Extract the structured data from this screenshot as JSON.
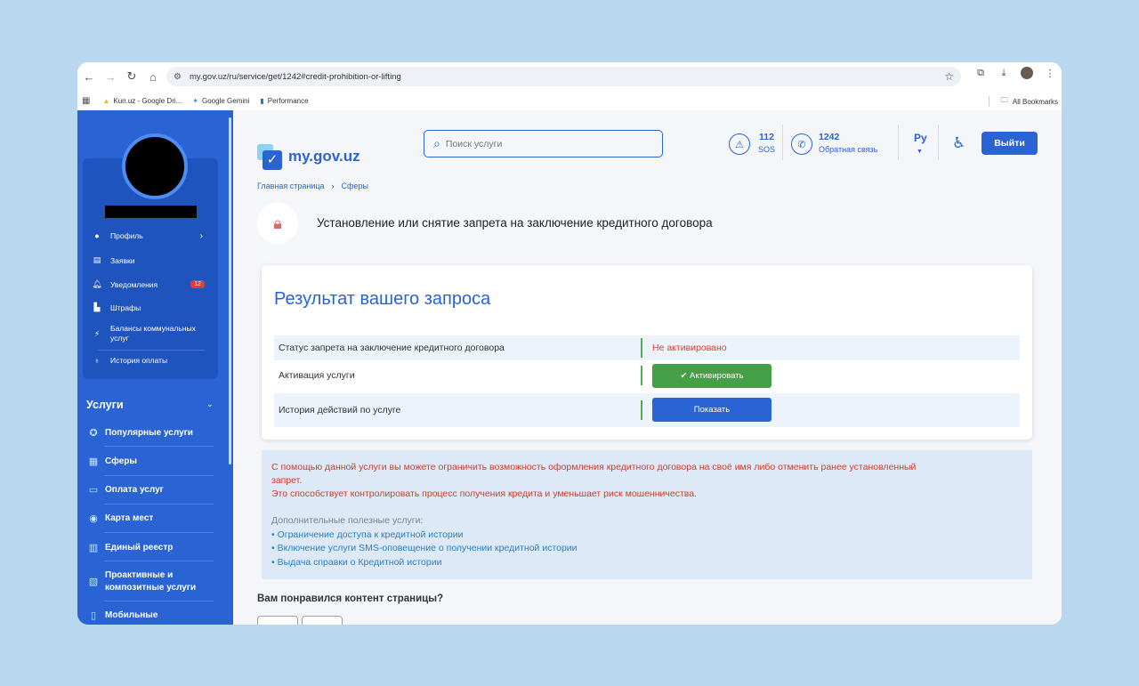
{
  "browser": {
    "url": "my.gov.uz/ru/service/get/1242#credit-prohibition-or-lifting",
    "bookmarks": [
      "Kun.uz - Google Dri...",
      "Google Gemini",
      "Performance"
    ],
    "all_bookmarks": "All Bookmarks"
  },
  "sidebar": {
    "profile_menu": [
      {
        "label": "Профиль",
        "icon": "user-icon"
      },
      {
        "label": "Заявки",
        "icon": "document-icon"
      },
      {
        "label": "Уведомления",
        "icon": "bell-icon",
        "badge": "12"
      },
      {
        "label": "Штрафы",
        "icon": "fine-icon"
      },
      {
        "label": "Балансы коммунальных услуг",
        "icon": "utility-icon"
      },
      {
        "label": "История оплаты",
        "icon": "money-bag-icon"
      }
    ],
    "services_title": "Услуги",
    "services": [
      {
        "label": "Популярные услуги",
        "icon": "popular-icon"
      },
      {
        "label": "Сферы",
        "icon": "grid-icon"
      },
      {
        "label": "Оплата услуг",
        "icon": "card-icon"
      },
      {
        "label": "Карта мест",
        "icon": "map-pin-icon"
      },
      {
        "label": "Единый реестр",
        "icon": "registry-icon"
      },
      {
        "label": "Проактивные и композитные услуги",
        "icon": "proactive-icon"
      },
      {
        "label": "Мобильные",
        "icon": "mobile-icon"
      }
    ]
  },
  "header": {
    "logo": "my.gov.uz",
    "search_placeholder": "Поиск услуги",
    "sos_number": "112",
    "sos_label": "SOS",
    "hotline_number": "1242",
    "hotline_label": "Обратная связь",
    "lang": "Ру",
    "logout": "Выйти"
  },
  "breadcrumb": [
    "Главная страница",
    "Сферы"
  ],
  "page_title": "Установление или снятие запрета на заключение кредитного договора",
  "result": {
    "title": "Результат вашего запроса",
    "rows": [
      {
        "label": "Статус запрета на заключение кредитного договора",
        "value": "Не активировано"
      },
      {
        "label": "Активация услуги",
        "button": "Активировать"
      },
      {
        "label": "История действий по услуге",
        "button": "Показать"
      }
    ]
  },
  "info": {
    "line1": "С помощью данной услуги вы можете ограничить возможность оформления кредитного договора на своё имя либо отменить ранее установленный",
    "line2": "запрет.",
    "line3": "Это способствует контролировать процесс получения кредита и уменьшает риск мошенничества.",
    "extra_title": "Дополнительные полезные услуги:",
    "links": [
      "• Ограничение доступа к кредитной истории",
      "• Включение услуги SMS-оповещение о получении кредитной истории",
      "• Выдача справки о Кредитной истории"
    ]
  },
  "feedback_question": "Вам понравился контент страницы?",
  "colors": {
    "accent": "#2a63d3",
    "success": "#43a047",
    "danger": "#e53935"
  }
}
